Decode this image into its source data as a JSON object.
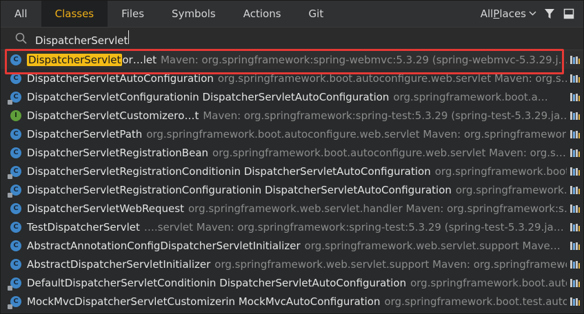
{
  "tabs": [
    "All",
    "Classes",
    "Files",
    "Symbols",
    "Actions",
    "Git"
  ],
  "active_tab": "Classes",
  "places": {
    "label_prefix": "All ",
    "label_underlined": "P",
    "label_rest": "laces"
  },
  "search": {
    "value": "DispatcherServlet"
  },
  "results": [
    {
      "icon": "class-icon",
      "kind": "c",
      "hl": "DispatcherServlet",
      "name": "",
      "rest": " or…let",
      "loc": "  Maven: org.springframework:spring-webmvc:5.3.29 (spring-webmvc-5.3.29.j…"
    },
    {
      "icon": "class-icon",
      "kind": "c",
      "name": "DispatcherServletAutoConfiguration",
      "rest": "",
      "loc": "org.springframework.boot.autoconfigure.web.servlet    Maven: org.s…"
    },
    {
      "icon": "class-icon",
      "kind": "c",
      "lock": true,
      "name": "DispatcherServletConfiguration",
      "rest": " in DispatcherServletAutoConfiguration",
      "loc": "org.springframework.boot.a…"
    },
    {
      "icon": "interface-icon",
      "kind": "i",
      "name": "DispatcherServletCustomizer",
      "rest": " o…t",
      "loc": "  Maven: org.springframework:spring-test:5.3.29 (spring-test-5.3.29.ja…"
    },
    {
      "icon": "class-icon",
      "kind": "c",
      "name": "DispatcherServletPath",
      "rest": "",
      "loc": "org.springframework.boot.autoconfigure.web.servlet    Maven: org.springframework…"
    },
    {
      "icon": "class-icon",
      "kind": "c",
      "name": "DispatcherServletRegistrationBean",
      "rest": "",
      "loc": "org.springframework.boot.autoconfigure.web.servlet    Maven: org.s…"
    },
    {
      "icon": "class-icon",
      "kind": "c",
      "lock": true,
      "name": "DispatcherServletRegistrationCondition",
      "rest": " in DispatcherServletAutoConfiguration",
      "loc": "org.springframework.boot.aut…"
    },
    {
      "icon": "class-icon",
      "kind": "c",
      "lock": true,
      "name": "DispatcherServletRegistrationConfiguration",
      "rest": " in DispatcherServletAutoConfiguration",
      "loc": "org.springframework…"
    },
    {
      "icon": "class-icon",
      "kind": "c",
      "name": "DispatcherServletWebRequest",
      "rest": "",
      "loc": "org.springframework.web.servlet.handler    Maven: org.springframework:s…"
    },
    {
      "icon": "class-icon",
      "kind": "c",
      "name": "TestDispatcherServlet",
      "rest": "",
      "loc": "….servlet   Maven: org.springframework:spring-test:5.3.29 (spring-test-5.3.29.ja…"
    },
    {
      "icon": "class-icon",
      "kind": "c",
      "name": "AbstractAnnotationConfigDispatcherServletInitializer",
      "rest": "",
      "loc": "org.springframework.web.servlet.support    Mave…"
    },
    {
      "icon": "class-icon",
      "kind": "c",
      "name": "AbstractDispatcherServletInitializer",
      "rest": "",
      "loc": "org.springframework.web.servlet.support    Maven: org.springframework…"
    },
    {
      "icon": "class-icon",
      "kind": "c",
      "lock": true,
      "name": "DefaultDispatcherServletCondition",
      "rest": " in DispatcherServletAutoConfiguration",
      "loc": "org.springframework.boot.autoco…"
    },
    {
      "icon": "class-icon",
      "kind": "c",
      "lock": true,
      "name": "MockMvcDispatcherServletCustomizer",
      "rest": " in MockMvcAutoConfiguration",
      "loc": "org.springframework.boot.test.autoconfi…"
    }
  ],
  "colors": {
    "highlight": "#f3bc16",
    "selection_border": "#e53935",
    "active_tab_text": "#f0b018"
  }
}
